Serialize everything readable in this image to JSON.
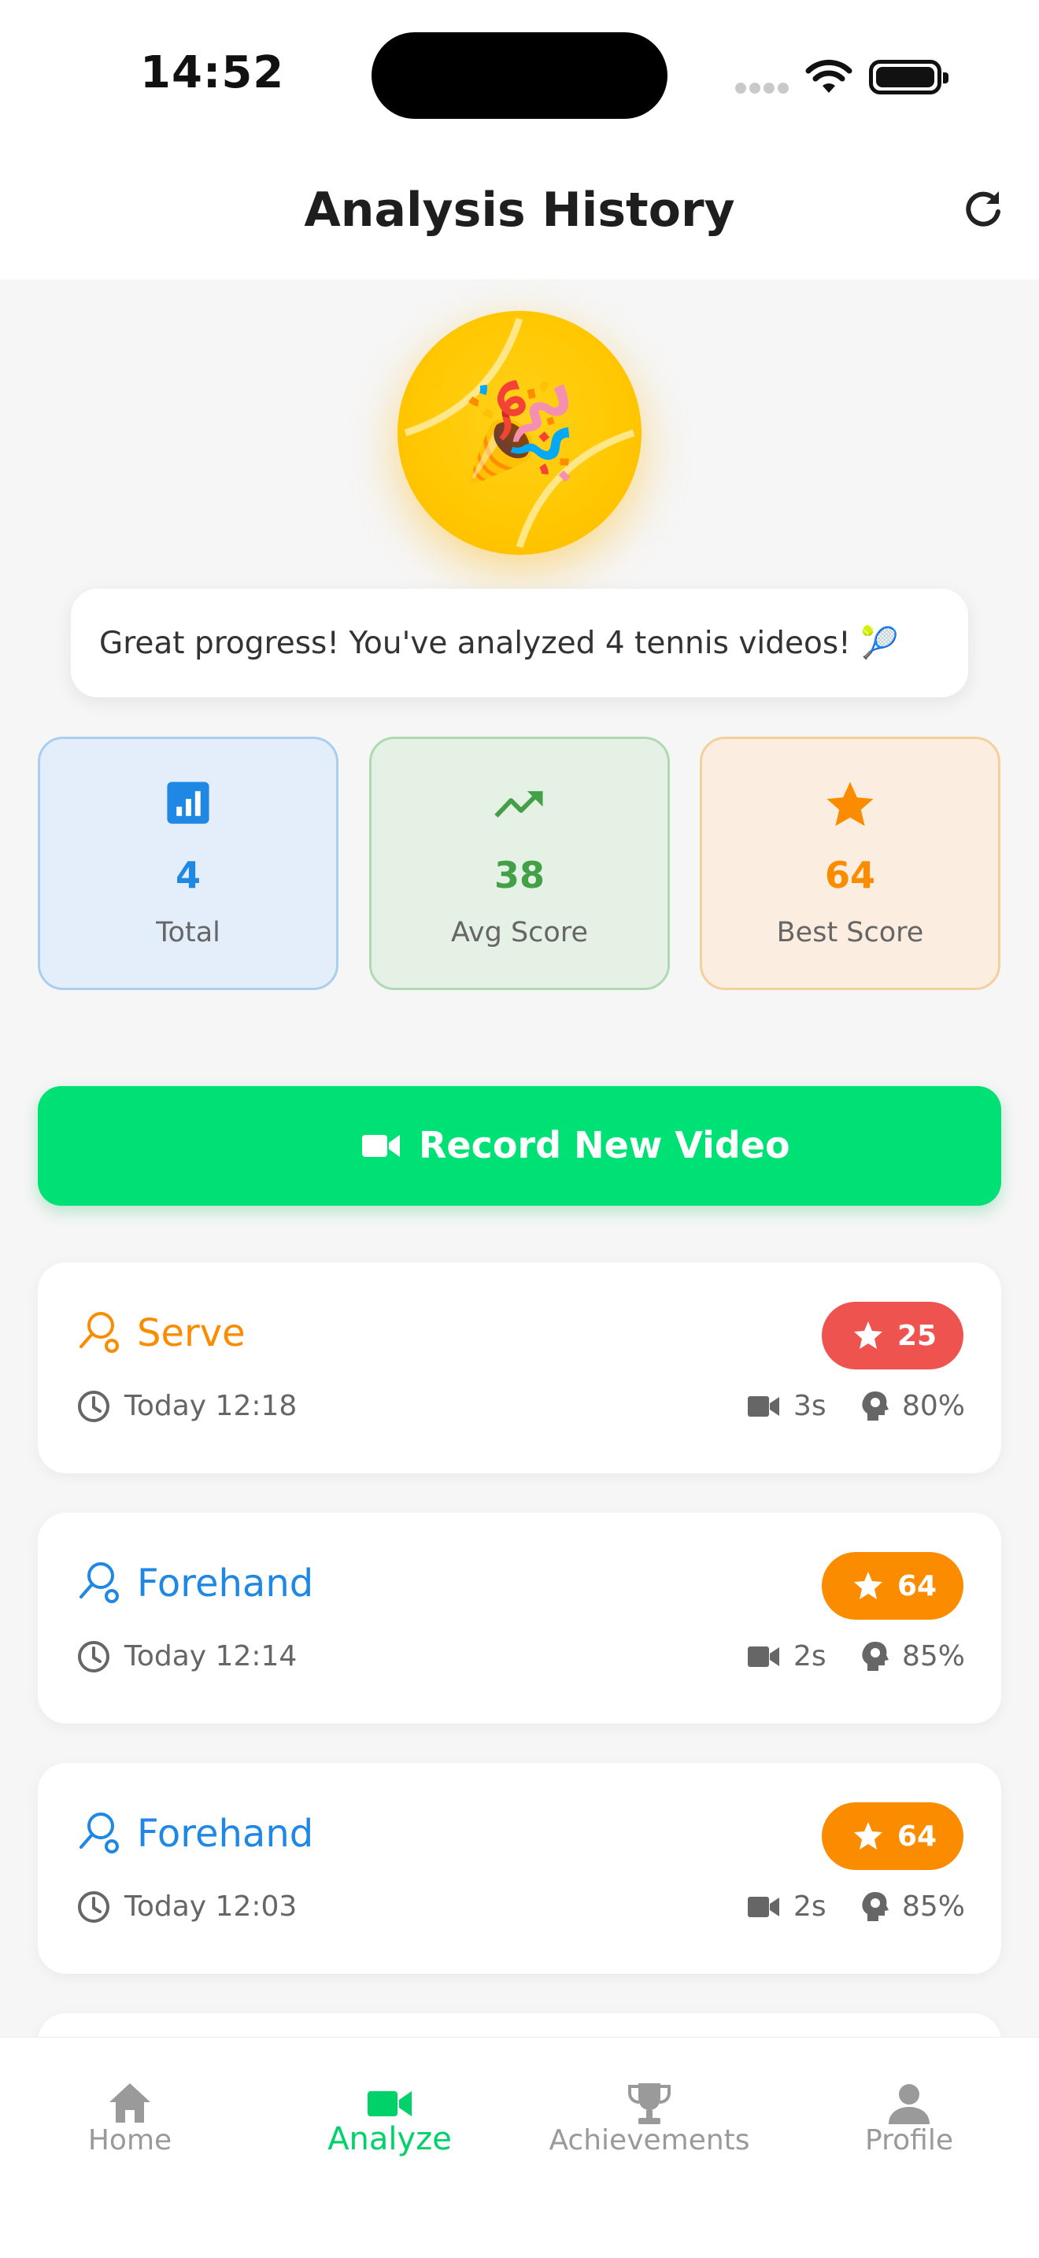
{
  "status_bar": {
    "time": "14:52"
  },
  "header": {
    "title": "Analysis History",
    "refresh_icon": "refresh-icon"
  },
  "hero": {
    "emoji": "🎉",
    "message": "Great progress! You've analyzed 4 tennis videos! 🎾"
  },
  "stats": [
    {
      "icon": "bar-chart-icon",
      "value": "4",
      "label": "Total",
      "color": "#1f88e5"
    },
    {
      "icon": "trending-up-icon",
      "value": "38",
      "label": "Avg Score",
      "color": "#43a047"
    },
    {
      "icon": "star-icon",
      "value": "64",
      "label": "Best Score",
      "color": "#fb8c00"
    }
  ],
  "record_button": {
    "label": "Record New Video",
    "icon": "video-camera-icon"
  },
  "analyses": [
    {
      "stroke": "Serve",
      "stroke_color": "#fb8c00",
      "score": "25",
      "badge_color": "#ef5350",
      "date": "Today 12:18",
      "duration": "3s",
      "confidence": "80%"
    },
    {
      "stroke": "Forehand",
      "stroke_color": "#1f88e5",
      "score": "64",
      "badge_color": "#fb8c00",
      "date": "Today 12:14",
      "duration": "2s",
      "confidence": "85%"
    },
    {
      "stroke": "Forehand",
      "stroke_color": "#1f88e5",
      "score": "64",
      "badge_color": "#fb8c00",
      "date": "Today 12:03",
      "duration": "2s",
      "confidence": "85%"
    }
  ],
  "bottom_nav": [
    {
      "label": "Home",
      "icon": "home-icon",
      "active": false
    },
    {
      "label": "Analyze",
      "icon": "video-camera-icon",
      "active": true
    },
    {
      "label": "Achievements",
      "icon": "trophy-icon",
      "active": false
    },
    {
      "label": "Profile",
      "icon": "person-icon",
      "active": false
    }
  ],
  "colors": {
    "accent": "#00e175",
    "background": "#f6f6f6"
  }
}
